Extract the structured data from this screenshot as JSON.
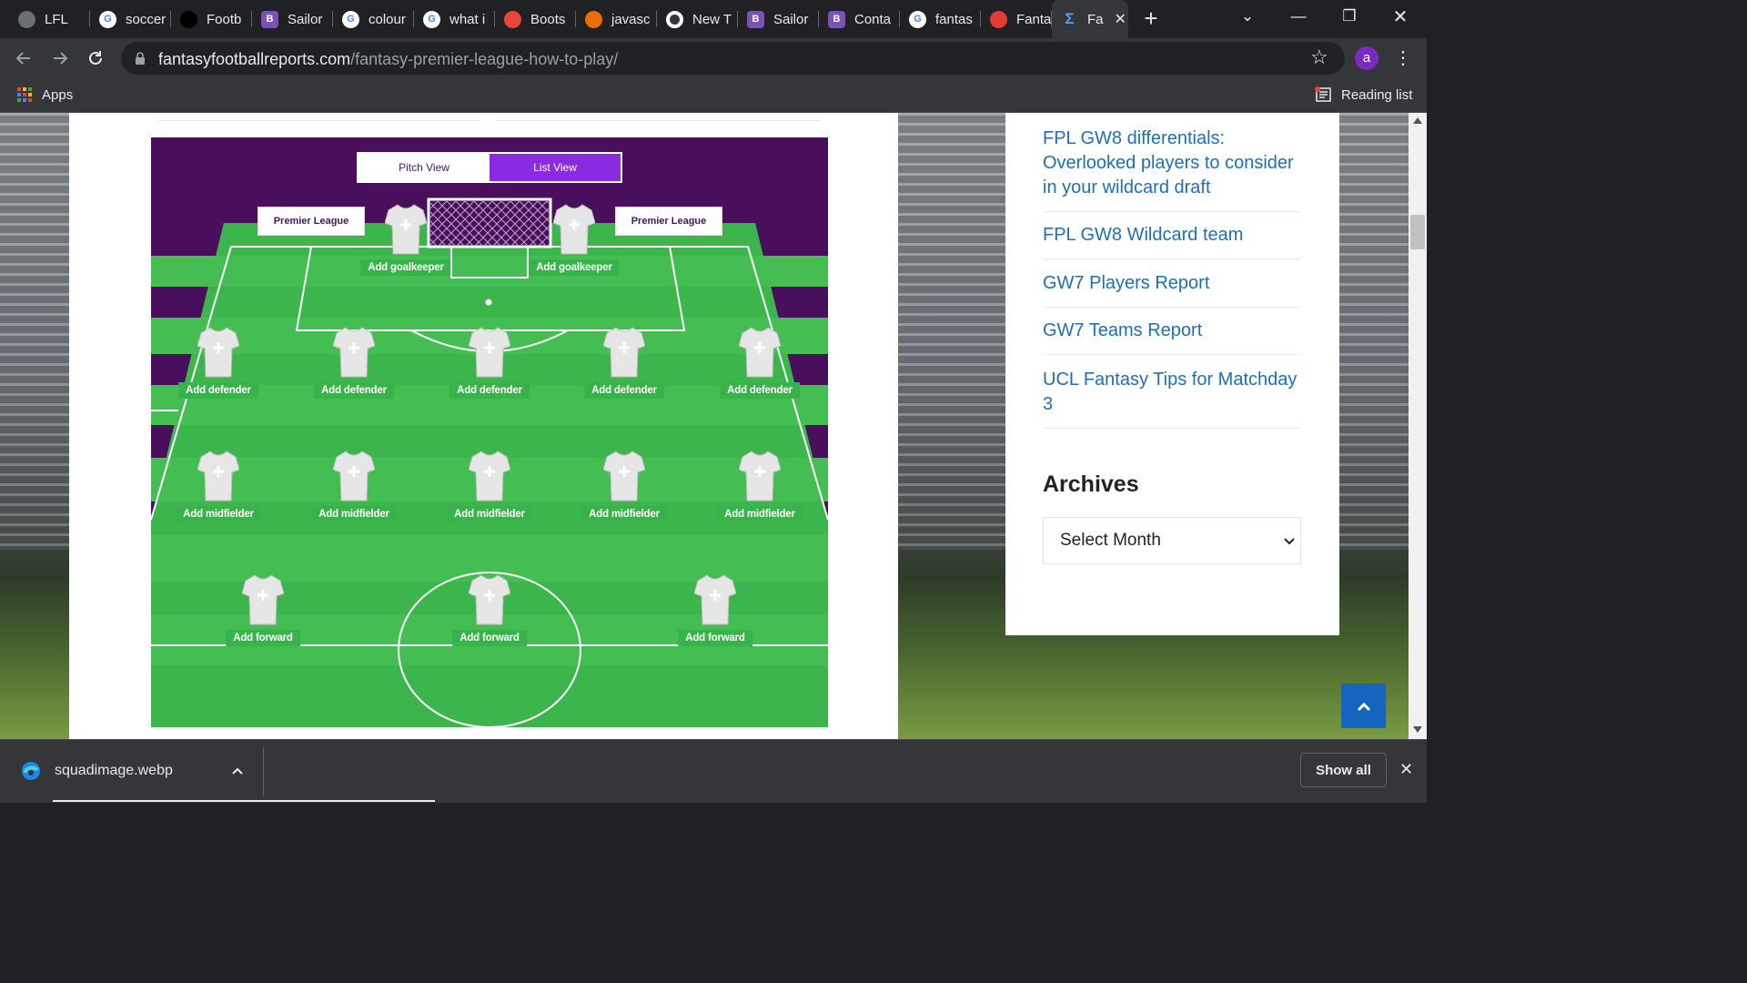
{
  "browser": {
    "tabs": [
      {
        "title": "LFL",
        "icon": "lfl-crest-icon",
        "color": "#6b6f73"
      },
      {
        "title": "soccer",
        "icon": "google-icon",
        "color": "#ffffff"
      },
      {
        "title": "Footb",
        "icon": "football-site-icon",
        "color": "#000000"
      },
      {
        "title": "Sailor",
        "icon": "bootstrap-icon",
        "color": "#7952b3"
      },
      {
        "title": "colour",
        "icon": "google-icon",
        "color": "#ffffff"
      },
      {
        "title": "what i",
        "icon": "google-icon",
        "color": "#ffffff"
      },
      {
        "title": "Boots",
        "icon": "colour-bars-icon",
        "color": "#e8443a"
      },
      {
        "title": "javasc",
        "icon": "java-icon",
        "color": "#e76f00"
      },
      {
        "title": "New T",
        "icon": "chrome-icon",
        "color": "#ffffff"
      },
      {
        "title": "Sailor",
        "icon": "bootstrap-icon",
        "color": "#7952b3"
      },
      {
        "title": "Conta",
        "icon": "bootstrap-icon",
        "color": "#7952b3"
      },
      {
        "title": "fantas",
        "icon": "google-icon",
        "color": "#ffffff"
      },
      {
        "title": "Fanta",
        "icon": "fantasy-red-icon",
        "color": "#e53935"
      },
      {
        "title": "Fa",
        "icon": "sigma-icon",
        "color": "#4ea1f3",
        "active": true
      }
    ],
    "new_tab_label": "+",
    "url_host": "fantasyfootballreports.com",
    "url_path": "/fantasy-premier-league-how-to-play/",
    "profile_initial": "a",
    "bookmarks": {
      "apps_label": "Apps",
      "reading_list_label": "Reading list"
    }
  },
  "squad": {
    "view_toggle": {
      "pitch_label": "Pitch View",
      "list_label": "List View",
      "active": "List View"
    },
    "banner_text": "Premier League",
    "goalkeepers": [
      "Add goalkeeper",
      "Add goalkeeper"
    ],
    "defenders": [
      "Add defender",
      "Add defender",
      "Add defender",
      "Add defender",
      "Add defender"
    ],
    "midfielders": [
      "Add midfielder",
      "Add midfielder",
      "Add midfielder",
      "Add midfielder",
      "Add midfielder"
    ],
    "forwards": [
      "Add forward",
      "Add forward",
      "Add forward"
    ]
  },
  "sidebar": {
    "recent_posts": [
      "FPL GW8 differentials: Overlooked players to consider in your wildcard draft",
      "FPL GW8 Wildcard team",
      "GW7 Players Report",
      "GW7 Teams Report",
      "UCL Fantasy Tips for Matchday 3"
    ],
    "archives_heading": "Archives",
    "archives_select": "Select Month"
  },
  "download_bar": {
    "file_name": "squadimage.webp",
    "show_all_label": "Show all"
  },
  "colors": {
    "link": "#1d6fb8",
    "pitch_green": "#37b34a",
    "squad_purple": "#4a0f5c",
    "toggle_active": "#8a2be2",
    "back_to_top": "#1565c0"
  }
}
